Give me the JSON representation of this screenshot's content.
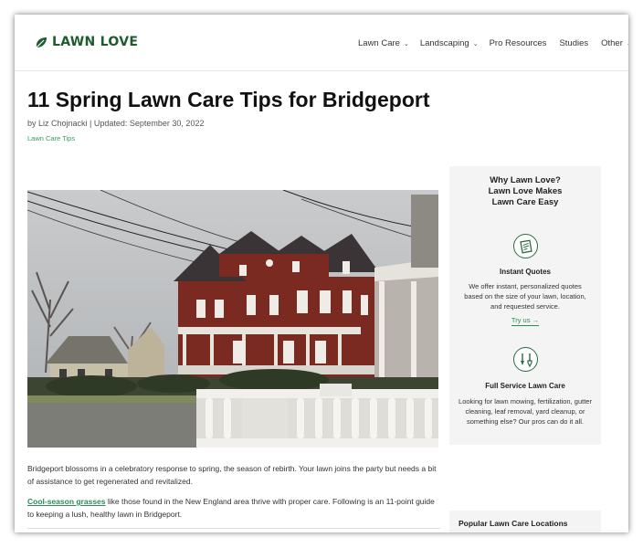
{
  "brand": {
    "name": "LAWN LOVE"
  },
  "nav": {
    "items": [
      {
        "label": "Lawn Care",
        "dropdown": true
      },
      {
        "label": "Landscaping",
        "dropdown": true
      },
      {
        "label": "Pro Resources",
        "dropdown": false
      },
      {
        "label": "Studies",
        "dropdown": false
      },
      {
        "label": "Other",
        "dropdown": true
      }
    ]
  },
  "article": {
    "title": "11 Spring Lawn Care Tips for Bridgeport",
    "byline": "by Liz Chojnacki | Updated: September 30, 2022",
    "category": "Lawn Care Tips",
    "paragraph1": "Bridgeport blossoms in a celebratory response to spring, the season of rebirth. Your lawn joins the party but needs a bit of assistance to get regenerated and revitalized.",
    "paragraph2_link": "Cool-season grasses",
    "paragraph2_rest": " like those found in the New England area thrive with proper care. Following is an 11-point guide to keeping a lush, healthy lawn in Bridgeport."
  },
  "sidebar": {
    "title_lines": [
      "Why Lawn Love?",
      "Lawn Love Makes",
      "Lawn Care Easy"
    ],
    "feature1": {
      "icon": "quote-document-icon",
      "title": "Instant Quotes",
      "desc": "We offer instant, personalized quotes based on the size of your lawn, location, and requested service.",
      "link": "Try us →"
    },
    "feature2": {
      "icon": "garden-tools-icon",
      "title": "Full Service Lawn Care",
      "desc": "Looking for lawn mowing, fertilization, gutter cleaning, leaf removal, yard cleanup, or something else? Our pros can do it all."
    },
    "popular_title": "Popular Lawn Care Locations"
  },
  "colors": {
    "brand_green": "#1e5b2f",
    "link_green": "#2e8b57"
  }
}
